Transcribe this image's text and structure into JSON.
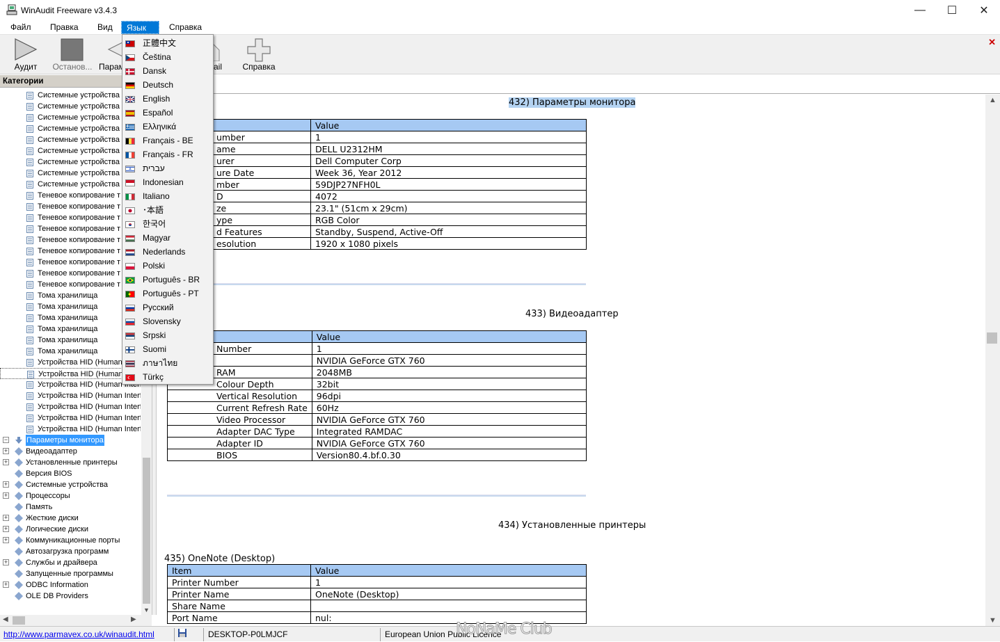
{
  "window": {
    "title": "WinAudit Freeware v3.4.3",
    "minimize": "—",
    "maximize": "☐",
    "close": "✕"
  },
  "menubar": {
    "items": [
      "Файл",
      "Правка",
      "Вид",
      "Язык",
      "Справка"
    ],
    "active": "Язык"
  },
  "toolbar": {
    "audit": "Аудит",
    "stop": "Останов...",
    "params": "Парам",
    "email": "ail",
    "help": "Справка"
  },
  "left_pane": {
    "header": "Категории",
    "tree": [
      "Системные устройства",
      "Системные устройства",
      "Системные устройства",
      "Системные устройства",
      "Системные устройства",
      "Системные устройства",
      "Системные устройства",
      "Системные устройства",
      "Системные устройства",
      "Теневое копирование т",
      "Теневое копирование т",
      "Теневое копирование т",
      "Теневое копирование т",
      "Теневое копирование т",
      "Теневое копирование т",
      "Теневое копирование т",
      "Теневое копирование т",
      "Теневое копирование т",
      "Тома хранилища",
      "Тома хранилища",
      "Тома хранилища",
      "Тома хранилища",
      "Тома хранилища",
      "Тома хранилища",
      "Устройства HID (Human",
      "Устройства HID (Human",
      "Устройства HID (Human Interf",
      "Устройства HID (Human Interf",
      "Устройства HID (Human Interf",
      "Устройства HID (Human Interf",
      "Устройства HID (Human Interf"
    ],
    "top_level": [
      {
        "label": "Параметры монитора",
        "expand": "−",
        "selected": true
      },
      {
        "label": "Видеоадаптер",
        "expand": "+"
      },
      {
        "label": "Установленные принтеры",
        "expand": "+"
      },
      {
        "label": "Версия BIOS",
        "expand": ""
      },
      {
        "label": "Системные устройства",
        "expand": "+"
      },
      {
        "label": "Процессоры",
        "expand": "+"
      },
      {
        "label": "Память",
        "expand": ""
      },
      {
        "label": "Жесткие диски",
        "expand": "+"
      },
      {
        "label": "Логические диски",
        "expand": "+"
      },
      {
        "label": "Коммуникационные порты",
        "expand": "+"
      },
      {
        "label": "Автозагрузка программ",
        "expand": ""
      },
      {
        "label": "Службы и драйвера",
        "expand": "+"
      },
      {
        "label": "Запущенные программы",
        "expand": ""
      },
      {
        "label": "ODBC Information",
        "expand": "+"
      },
      {
        "label": "OLE DB Providers",
        "expand": ""
      }
    ]
  },
  "language_menu": [
    {
      "label": "正體中文",
      "flag": "taiwan"
    },
    {
      "label": "Čeština",
      "flag": "czech"
    },
    {
      "label": "Dansk",
      "flag": "denmark"
    },
    {
      "label": "Deutsch",
      "flag": "germany"
    },
    {
      "label": "English",
      "flag": "uk"
    },
    {
      "label": "Español",
      "flag": "spain"
    },
    {
      "label": "Ελληνικά",
      "flag": "greece"
    },
    {
      "label": "Français - BE",
      "flag": "belgium"
    },
    {
      "label": "Français - FR",
      "flag": "france"
    },
    {
      "label": "עברית",
      "flag": "israel"
    },
    {
      "label": "Indonesian",
      "flag": "indonesia"
    },
    {
      "label": "Italiano",
      "flag": "italy"
    },
    {
      "label": "･本語",
      "flag": "japan"
    },
    {
      "label": "한국어",
      "flag": "korea"
    },
    {
      "label": "Magyar",
      "flag": "hungary"
    },
    {
      "label": "Nederlands",
      "flag": "netherlands"
    },
    {
      "label": "Polski",
      "flag": "poland"
    },
    {
      "label": "Português - BR",
      "flag": "brazil"
    },
    {
      "label": "Português - PT",
      "flag": "portugal"
    },
    {
      "label": "Русский",
      "flag": "russia"
    },
    {
      "label": "Slovensky",
      "flag": "slovakia"
    },
    {
      "label": "Srpski",
      "flag": "serbia"
    },
    {
      "label": "Suomi",
      "flag": "finland"
    },
    {
      "label": "ภาษาไทย",
      "flag": "thailand"
    },
    {
      "label": "Türkç",
      "flag": "turkey"
    }
  ],
  "report": {
    "monitor": {
      "title": "432) Параметры монитора",
      "header": [
        "",
        "Value"
      ],
      "rows": [
        [
          "umber",
          "1"
        ],
        [
          "ame",
          "DELL U2312HM"
        ],
        [
          "urer",
          "Dell Computer Corp"
        ],
        [
          "ure Date",
          "Week 36, Year 2012"
        ],
        [
          "mber",
          "59DJP27NFH0L"
        ],
        [
          "D",
          "4072"
        ],
        [
          "ze",
          "23.1\" (51cm x 29cm)"
        ],
        [
          "ype",
          "RGB Color"
        ],
        [
          "d Features",
          "Standby, Suspend, Active-Off"
        ],
        [
          "esolution",
          "1920 x 1080 pixels"
        ]
      ]
    },
    "video": {
      "title": "433) Видеоадаптер",
      "header": [
        "",
        "Value"
      ],
      "rows": [
        [
          "Number",
          "1"
        ],
        [
          "",
          "NVIDIA GeForce GTX 760"
        ],
        [
          "RAM",
          "2048MB"
        ],
        [
          "Colour Depth",
          "32bit"
        ],
        [
          "Vertical Resolution",
          "96dpi"
        ],
        [
          "Current Refresh Rate",
          "60Hz"
        ],
        [
          "Video Processor",
          "NVIDIA GeForce GTX 760"
        ],
        [
          "Adapter DAC Type",
          "Integrated RAMDAC"
        ],
        [
          "Adapter ID",
          "NVIDIA GeForce GTX 760"
        ],
        [
          "BIOS",
          "Version80.4.bf.0.30"
        ]
      ]
    },
    "printers": {
      "title": "434) Установленные принтеры"
    },
    "onenote": {
      "title": "435) OneNote (Desktop)",
      "header": [
        "Item",
        "Value"
      ],
      "rows": [
        [
          "Printer Number",
          "1"
        ],
        [
          "Printer Name",
          "OneNote (Desktop)"
        ],
        [
          "Share Name",
          ""
        ],
        [
          "Port Name",
          "nul:"
        ]
      ]
    }
  },
  "statusbar": {
    "url": "http://www.parmavex.co.uk/winaudit.html",
    "computer": "DESKTOP-P0LMJCF",
    "licence": "European Union Public Licence"
  },
  "watermark": "NoNaMe Club"
}
